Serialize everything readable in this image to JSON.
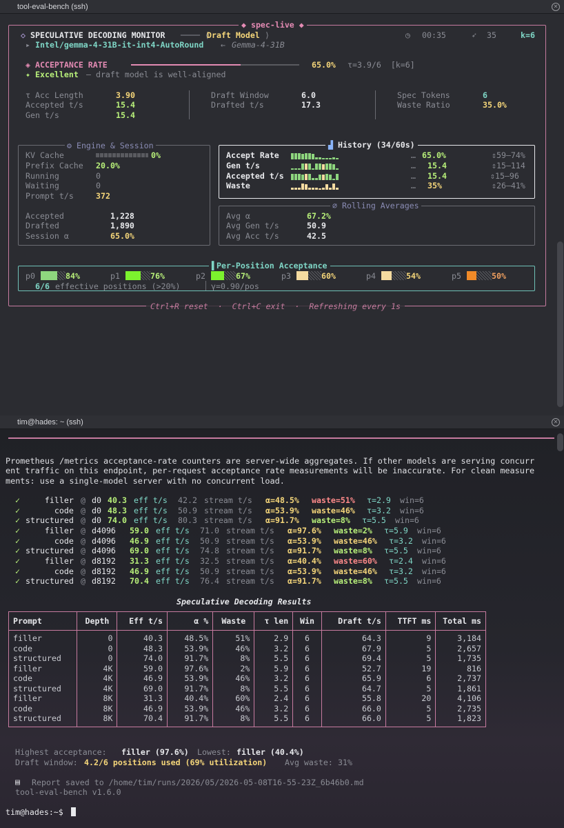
{
  "window1": {
    "title": "tool-eval-bench (ssh)"
  },
  "window2": {
    "title": "tim@hades: ~ (ssh)"
  },
  "monitor": {
    "frame_title": "◆ spec-live ◆",
    "header_title": "SPECULATIVE DECODING MONITOR",
    "header_sep": "──── ⟨",
    "header_sub": "Draft Model",
    "header_sub_close": "⟩",
    "timer": "00:35",
    "count": "35",
    "k": "k=6",
    "model": "Intel/gemma-4-31B-it-int4-AutoRound",
    "model_arrow": "←",
    "model_target": "Gemma-4-31B",
    "acceptance_label": "ACCEPTANCE RATE",
    "acceptance_value": "65.0%",
    "acceptance_fraction": 0.65,
    "tau_text": "τ=3.9/6  [k=6]",
    "quality": "Excellent",
    "quality_desc": "— draft model is well-aligned",
    "stats": [
      {
        "label": "τ Acc Length",
        "value": "3.90"
      },
      {
        "label": "Accepted t/s",
        "value": "15.4"
      },
      {
        "label": "Gen t/s",
        "value": "15.4"
      },
      {
        "label": "Draft Window",
        "value": "6.0"
      },
      {
        "label": "Drafted t/s",
        "value": "17.3"
      },
      {
        "label": "Spec Tokens",
        "value": "6"
      },
      {
        "label": "Waste Ratio",
        "value": "35.0%"
      }
    ],
    "engine": {
      "title": "⚙ Engine & Session",
      "kv_label": "KV Cache",
      "kv_value": "0%",
      "prefix_label": "Prefix Cache",
      "prefix_value": "20.0%",
      "running_label": "Running",
      "running_value": "0",
      "waiting_label": "Waiting",
      "waiting_value": "0",
      "prompt_label": "Prompt t/s",
      "prompt_value": "372",
      "accepted_label": "Accepted",
      "accepted_value": "1,228",
      "drafted_label": "Drafted",
      "drafted_value": "1,890",
      "session_label": "Session α",
      "session_value": "65.0%"
    },
    "history": {
      "title": "History (34/60s)",
      "rows": [
        {
          "label": "Accept Rate",
          "value": "65.0%",
          "range": "⇕59–74%",
          "color": "#8ed67e"
        },
        {
          "label": "Gen t/s",
          "value": "15.4",
          "range": "⇕15–114",
          "color": "#8ed67e"
        },
        {
          "label": "Accepted t/s",
          "value": "15.4",
          "range": "⇕15–96",
          "color": "#8ed67e"
        },
        {
          "label": "Waste",
          "value": "35%",
          "range": "⇕26–41%",
          "color": "#f5dba0"
        }
      ]
    },
    "rolling": {
      "title": "⌀ Rolling Averages",
      "avg_alpha_label": "Avg α",
      "avg_alpha_value": "67.2%",
      "avg_gen_label": "Avg Gen t/s",
      "avg_gen_value": "50.9",
      "avg_acc_label": "Avg Acc t/s",
      "avg_acc_value": "42.5"
    },
    "positions": {
      "title": "Per-Position Acceptance",
      "items": [
        {
          "label": "p0",
          "value": "84%",
          "fraction": 0.84,
          "color": "#8ed67e"
        },
        {
          "label": "p1",
          "value": "76%",
          "fraction": 0.76,
          "color": "#7cf22e"
        },
        {
          "label": "p2",
          "value": "67%",
          "fraction": 0.67,
          "color": "#7cf22e"
        },
        {
          "label": "p3",
          "value": "60%",
          "fraction": 0.6,
          "color": "#f5dba0"
        },
        {
          "label": "p4",
          "value": "54%",
          "fraction": 0.54,
          "color": "#f5dba0"
        },
        {
          "label": "p5",
          "value": "50%",
          "fraction": 0.5,
          "color": "#f08a28"
        }
      ],
      "effective": "6/6",
      "effective_desc": "effective positions (>20%)",
      "gamma": "γ=0.90/pos"
    },
    "footer": "Ctrl+R reset  ·  Ctrl+C exit  ·  Refreshing every 1s"
  },
  "terminal": {
    "warning": "Prometheus /metrics acceptance-rate counters are server-wide aggregates. If other models are serving concurr\nent traffic on this endpoint, per-request acceptance rate measurements will be inaccurate. For clean measure\nments: use a single-model server with no concurrent load.",
    "runs": [
      {
        "check": "✓",
        "prompt": "    filler",
        "depth": "d0",
        "eff": "40.3",
        "stream": "42.2",
        "alpha": "α=48.5%",
        "waste": "waste=51%",
        "tau": "τ=2.9",
        "win": "win=6",
        "wc": "#ff8a8a"
      },
      {
        "check": "✓",
        "prompt": "      code",
        "depth": "d0",
        "eff": "48.3",
        "stream": "50.9",
        "alpha": "α=53.9%",
        "waste": "waste=46%",
        "tau": "τ=3.2",
        "win": "win=6",
        "wc": "#f5d67a"
      },
      {
        "check": "✓",
        "prompt": "structured",
        "depth": "d0",
        "eff": "74.0",
        "stream": "80.3",
        "alpha": "α=91.7%",
        "waste": "waste=8%",
        "tau": "τ=5.5",
        "win": "win=6",
        "wc": "#b8f07a"
      },
      {
        "check": "✓",
        "prompt": "    filler",
        "depth": "d4096",
        "eff": "59.0",
        "stream": "71.0",
        "alpha": "α=97.6%",
        "waste": "waste=2%",
        "tau": "τ=5.9",
        "win": "win=6",
        "wc": "#b8f07a"
      },
      {
        "check": "✓",
        "prompt": "      code",
        "depth": "d4096",
        "eff": "46.9",
        "stream": "50.9",
        "alpha": "α=53.9%",
        "waste": "waste=46%",
        "tau": "τ=3.2",
        "win": "win=6",
        "wc": "#f5d67a"
      },
      {
        "check": "✓",
        "prompt": "structured",
        "depth": "d4096",
        "eff": "69.0",
        "stream": "74.8",
        "alpha": "α=91.7%",
        "waste": "waste=8%",
        "tau": "τ=5.5",
        "win": "win=6",
        "wc": "#b8f07a"
      },
      {
        "check": "✓",
        "prompt": "    filler",
        "depth": "d8192",
        "eff": "31.3",
        "stream": "32.5",
        "alpha": "α=40.4%",
        "waste": "waste=60%",
        "tau": "τ=2.4",
        "win": "win=6",
        "wc": "#ff8a8a"
      },
      {
        "check": "✓",
        "prompt": "      code",
        "depth": "d8192",
        "eff": "46.9",
        "stream": "50.9",
        "alpha": "α=53.9%",
        "waste": "waste=46%",
        "tau": "τ=3.2",
        "win": "win=6",
        "wc": "#f5d67a"
      },
      {
        "check": "✓",
        "prompt": "structured",
        "depth": "d8192",
        "eff": "70.4",
        "stream": "76.4",
        "alpha": "α=91.7%",
        "waste": "waste=8%",
        "tau": "τ=5.5",
        "win": "win=6",
        "wc": "#b8f07a"
      }
    ],
    "eff_unit": "eff t/s",
    "stream_unit": "stream t/s",
    "table_title": "Speculative Decoding Results",
    "columns": [
      "Prompt",
      "Depth",
      "Eff t/s",
      "α %",
      "Waste",
      "τ len",
      "Win",
      "Draft t/s",
      "TTFT ms",
      "Total ms"
    ],
    "rows": [
      [
        "filler",
        "0",
        "40.3",
        "48.5%",
        "51%",
        "2.9",
        "6",
        "64.3",
        "9",
        "3,184"
      ],
      [
        "code",
        "0",
        "48.3",
        "53.9%",
        "46%",
        "3.2",
        "6",
        "67.9",
        "5",
        "2,657"
      ],
      [
        "structured",
        "0",
        "74.0",
        "91.7%",
        "8%",
        "5.5",
        "6",
        "69.4",
        "5",
        "1,735"
      ],
      [
        "filler",
        "4K",
        "59.0",
        "97.6%",
        "2%",
        "5.9",
        "6",
        "52.7",
        "19",
        "816"
      ],
      [
        "code",
        "4K",
        "46.9",
        "53.9%",
        "46%",
        "3.2",
        "6",
        "65.9",
        "6",
        "2,737"
      ],
      [
        "structured",
        "4K",
        "69.0",
        "91.7%",
        "8%",
        "5.5",
        "6",
        "64.7",
        "5",
        "1,861"
      ],
      [
        "filler",
        "8K",
        "31.3",
        "40.4%",
        "60%",
        "2.4",
        "6",
        "55.8",
        "20",
        "4,106"
      ],
      [
        "code",
        "8K",
        "46.9",
        "53.9%",
        "46%",
        "3.2",
        "6",
        "66.0",
        "5",
        "2,735"
      ],
      [
        "structured",
        "8K",
        "70.4",
        "91.7%",
        "8%",
        "5.5",
        "6",
        "66.0",
        "5",
        "1,823"
      ]
    ],
    "summary": {
      "highest_label": "Highest acceptance:",
      "highest_value": "filler (97.6%)",
      "lowest_label": "Lowest:",
      "lowest_value": "filler (40.4%)",
      "window_label": "Draft window:",
      "window_value": "4.2/6 positions used (69% utilization)",
      "avg_waste_label": "Avg waste:",
      "avg_waste_value": "31%"
    },
    "report": "Report saved to /home/tim/runs/2026/05/2026-05-08T16-55-23Z_6b46b0.md",
    "version": "tool-eval-bench v1.6.0",
    "prompt": "tim@hades:~$"
  }
}
